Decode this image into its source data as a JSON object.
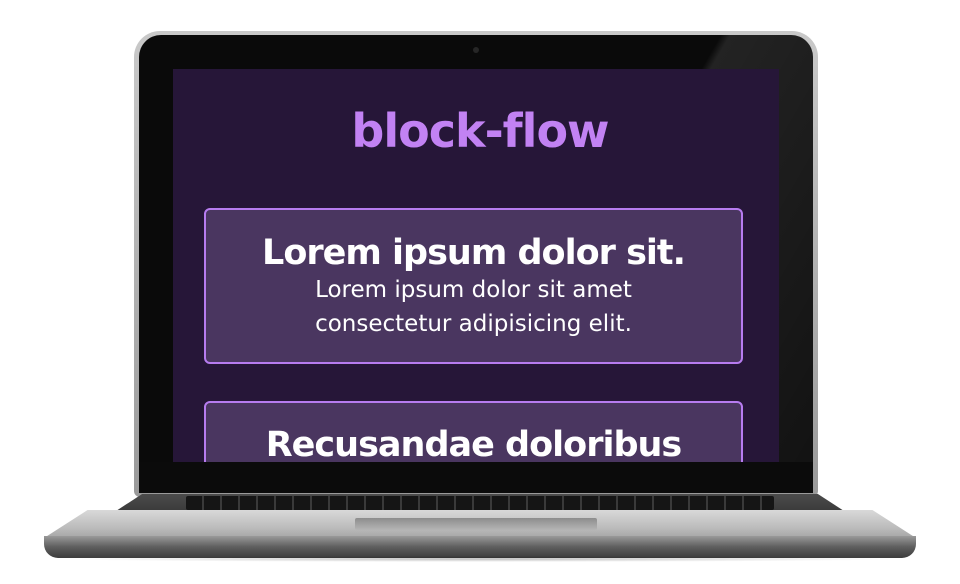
{
  "page": {
    "title": "block-flow"
  },
  "cards": [
    {
      "heading": "Lorem ipsum dolor sit.",
      "body": "Lorem ipsum dolor sit amet consectetur adipisicing elit."
    },
    {
      "heading": "Recusandae doloribus"
    }
  ],
  "colors": {
    "background": "#261638",
    "title": "#c282f3",
    "card_fill": "#4a3660",
    "card_border": "#b77cf0",
    "text": "#ffffff"
  },
  "device": {
    "type": "laptop-mockup"
  }
}
